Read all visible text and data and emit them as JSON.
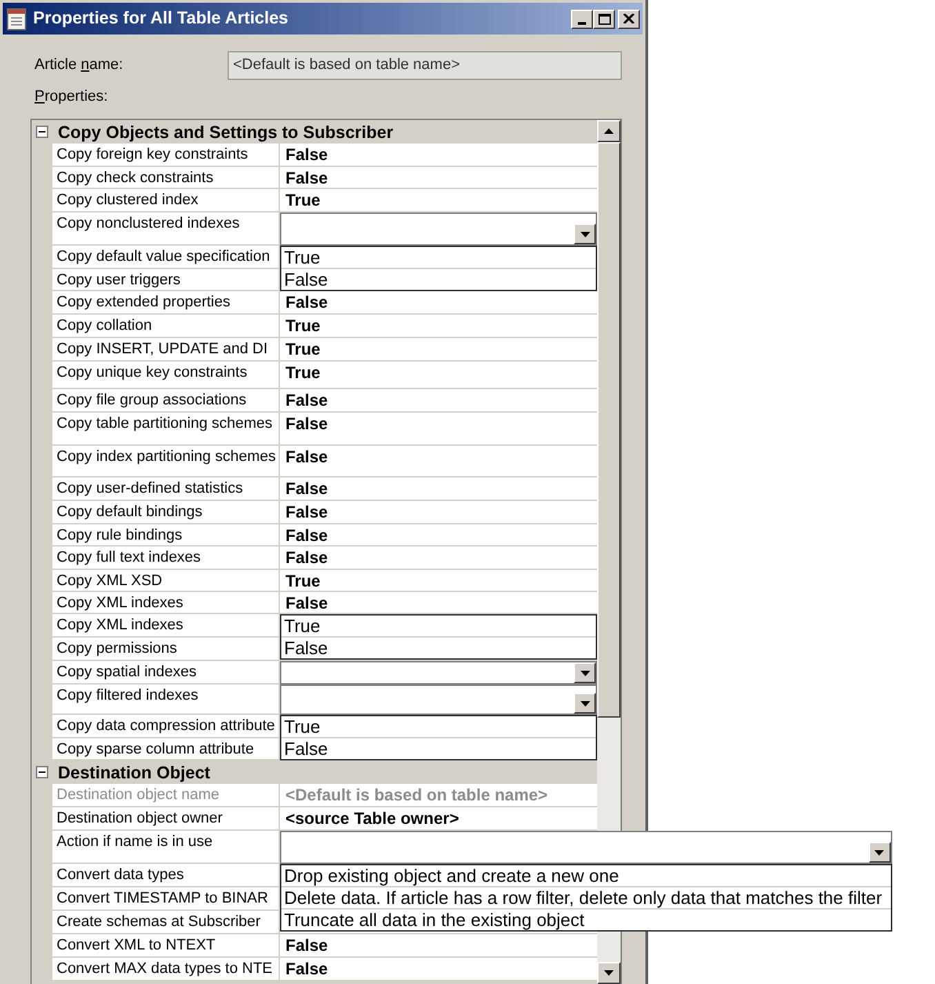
{
  "window": {
    "title": "Properties for All Table Articles"
  },
  "article_name": {
    "label": {
      "before": "Article ",
      "access_key": "n",
      "after": "ame:"
    },
    "value": "<Default is based on table name>"
  },
  "properties_label": {
    "access_key": "P",
    "after": "roperties:"
  },
  "property_grid": {
    "categories": [
      {
        "title": "Copy Objects and Settings to Subscriber",
        "expanded": true,
        "rows": [
          {
            "name": "Copy foreign key constraints",
            "kind": "text",
            "value": "False",
            "disabled": false
          },
          {
            "name": "Copy check constraints",
            "kind": "text",
            "value": "False",
            "disabled": false
          },
          {
            "name": "Copy clustered index",
            "kind": "text",
            "value": "True",
            "disabled": false
          },
          {
            "name": "Copy nonclustered indexes",
            "kind": "combo",
            "disabled": false,
            "options": [
              "True",
              "False"
            ]
          },
          {
            "name": "Copy default value specification",
            "kind": "text",
            "disabled": false
          },
          {
            "name": "Copy user triggers",
            "kind": "text",
            "disabled": false
          },
          {
            "name": "Copy extended properties",
            "kind": "text",
            "value": "False",
            "disabled": false
          },
          {
            "name": "Copy collation",
            "kind": "text",
            "value": "True",
            "disabled": false
          },
          {
            "name": "Copy INSERT, UPDATE and DI",
            "kind": "text",
            "value": "True",
            "disabled": false
          },
          {
            "name": "Copy unique key constraints",
            "kind": "text",
            "value": "True",
            "disabled": false
          },
          {
            "name": "Copy file group associations",
            "kind": "text",
            "value": "False",
            "disabled": false
          },
          {
            "name": "Copy table partitioning schemes",
            "kind": "text",
            "value": "False",
            "disabled": false
          },
          {
            "name": "Copy index partitioning schemes",
            "kind": "text",
            "value": "False",
            "disabled": false
          },
          {
            "name": "Copy user-defined statistics",
            "kind": "text",
            "value": "False",
            "disabled": false
          },
          {
            "name": "Copy default bindings",
            "kind": "text",
            "value": "False",
            "disabled": false
          },
          {
            "name": "Copy rule bindings",
            "kind": "text",
            "value": "False",
            "disabled": false
          },
          {
            "name": "Copy full text indexes",
            "kind": "text",
            "value": "False",
            "disabled": false
          },
          {
            "name": "Copy XML XSD",
            "kind": "text",
            "value": "True",
            "disabled": false
          },
          {
            "name": "Copy XML indexes",
            "kind": "text",
            "value": "False",
            "disabled": false,
            "options": [
              "True",
              "False"
            ]
          },
          {
            "name": "Copy XML indexes",
            "kind": "text",
            "disabled": false
          },
          {
            "name": "Copy permissions",
            "kind": "text",
            "disabled": false
          },
          {
            "name": "Copy spatial indexes",
            "kind": "combo",
            "disabled": false
          },
          {
            "name": "Copy filtered indexes",
            "kind": "combo",
            "disabled": false,
            "options": [
              "True",
              "False"
            ]
          },
          {
            "name": "Copy data compression attribute",
            "kind": "text",
            "disabled": false
          },
          {
            "name": "Copy sparse column attribute",
            "kind": "text",
            "disabled": false
          }
        ]
      },
      {
        "title": "Destination Object",
        "expanded": true,
        "rows": [
          {
            "name": "Destination object name",
            "kind": "text",
            "value": "<Default is based on table name>",
            "disabled": true
          },
          {
            "name": "Destination object owner",
            "kind": "text",
            "value": "<source Table owner>",
            "disabled": false
          },
          {
            "name": "Action if name is in use",
            "kind": "combo",
            "disabled": false,
            "options": [
              "Drop existing object and create a new one",
              "Delete data. If article has a row filter, delete only data that matches the filter",
              "Truncate all data in the existing object"
            ]
          },
          {
            "name": "Convert data types",
            "kind": "text",
            "disabled": false
          },
          {
            "name": "Convert TIMESTAMP to BINAR",
            "kind": "text",
            "disabled": false
          },
          {
            "name": "Create schemas at Subscriber",
            "kind": "text",
            "disabled": false
          },
          {
            "name": "Convert XML to NTEXT",
            "kind": "text",
            "value": "False",
            "disabled": false
          },
          {
            "name": "Convert MAX data types to NTE",
            "kind": "text",
            "value": "False",
            "disabled": false
          }
        ]
      }
    ]
  }
}
